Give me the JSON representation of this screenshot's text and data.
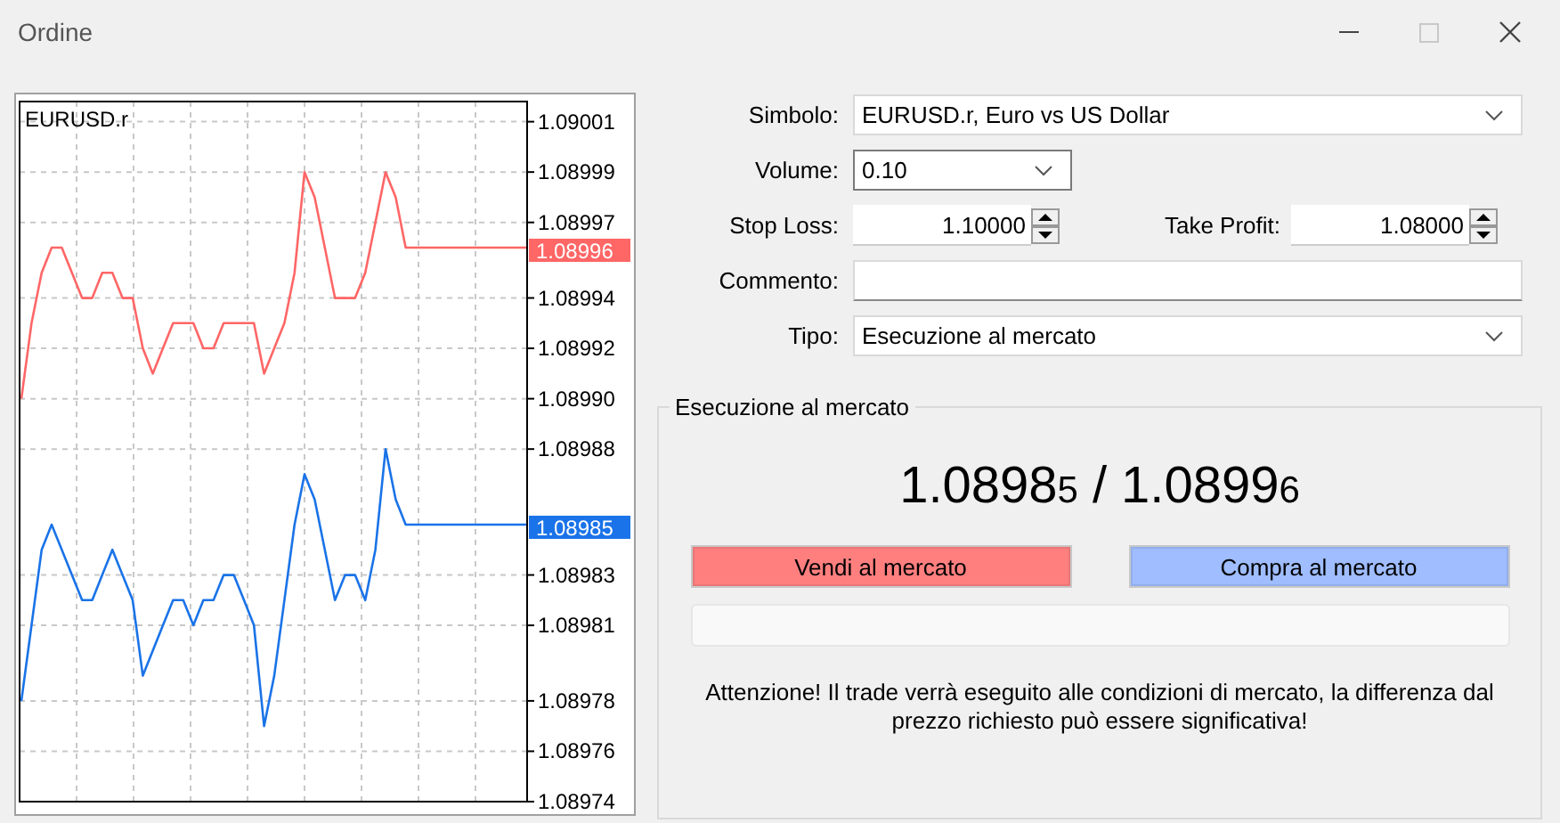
{
  "window": {
    "title": "Ordine",
    "maximize_disabled": true
  },
  "chart": {
    "price_tags": [
      {
        "label": "1.08996",
        "color": "#ff6666"
      },
      {
        "label": "1.08985",
        "color": "#1a73e8"
      }
    ],
    "chart_data": {
      "type": "line",
      "title": "EURUSD.r",
      "grid": true,
      "ylim": [
        1.08974,
        1.090018
      ],
      "yticks": [
        {
          "value": 1.09001,
          "label": "1.09001"
        },
        {
          "value": 1.08999,
          "label": "1.08999"
        },
        {
          "value": 1.08997,
          "label": "1.08997"
        },
        {
          "value": 1.08994,
          "label": "1.08994"
        },
        {
          "value": 1.08992,
          "label": "1.08992"
        },
        {
          "value": 1.0899,
          "label": "1.08990"
        },
        {
          "value": 1.08988,
          "label": "1.08988"
        },
        {
          "value": 1.08983,
          "label": "1.08983"
        },
        {
          "value": 1.08981,
          "label": "1.08981"
        },
        {
          "value": 1.08978,
          "label": "1.08978"
        },
        {
          "value": 1.08976,
          "label": "1.08976"
        },
        {
          "value": 1.08974,
          "label": "1.08974"
        }
      ],
      "series": [
        {
          "color": "#ff6666",
          "values": [
            1.0899,
            1.08993,
            1.08995,
            1.08996,
            1.08996,
            1.08995,
            1.08994,
            1.08994,
            1.08995,
            1.08995,
            1.08994,
            1.08994,
            1.08992,
            1.08991,
            1.08992,
            1.08993,
            1.08993,
            1.08993,
            1.08992,
            1.08992,
            1.08993,
            1.08993,
            1.08993,
            1.08993,
            1.08991,
            1.08992,
            1.08993,
            1.08995,
            1.08999,
            1.08998,
            1.08996,
            1.08994,
            1.08994,
            1.08994,
            1.08995,
            1.08997,
            1.08999,
            1.08998,
            1.08996,
            1.08996,
            1.08996,
            1.08996,
            1.08996,
            1.08996,
            1.08996,
            1.08996,
            1.08996,
            1.08996,
            1.08996,
            1.08996,
            1.08996
          ]
        },
        {
          "color": "#1a73e8",
          "values": [
            1.08978,
            1.08981,
            1.08984,
            1.08985,
            1.08984,
            1.08983,
            1.08982,
            1.08982,
            1.08983,
            1.08984,
            1.08983,
            1.08982,
            1.08979,
            1.0898,
            1.08981,
            1.08982,
            1.08982,
            1.08981,
            1.08982,
            1.08982,
            1.08983,
            1.08983,
            1.08982,
            1.08981,
            1.08977,
            1.08979,
            1.08982,
            1.08985,
            1.08987,
            1.08986,
            1.08984,
            1.08982,
            1.08983,
            1.08983,
            1.08982,
            1.08984,
            1.08988,
            1.08986,
            1.08985,
            1.08985,
            1.08985,
            1.08985,
            1.08985,
            1.08985,
            1.08985,
            1.08985,
            1.08985,
            1.08985,
            1.08985,
            1.08985,
            1.08985
          ]
        }
      ]
    }
  },
  "form": {
    "symbol": {
      "label": "Simbolo:",
      "value": "EURUSD.r, Euro vs US Dollar"
    },
    "volume": {
      "label": "Volume:",
      "value": "0.10"
    },
    "stop_loss": {
      "label": "Stop Loss:",
      "value": "1.10000"
    },
    "take_profit": {
      "label": "Take Profit:",
      "value": "1.08000"
    },
    "comment": {
      "label": "Commento:"
    },
    "type": {
      "label": "Tipo:",
      "value": "Esecuzione al mercato"
    }
  },
  "execution": {
    "title": "Esecuzione al mercato",
    "bid": {
      "main": "1.0898",
      "pip": "5"
    },
    "separator": "/",
    "ask": {
      "main": "1.0899",
      "pip": "6"
    },
    "sell_button": "Vendi al mercato",
    "buy_button": "Compra al mercato",
    "warning": "Attenzione! Il trade verrà eseguito alle condizioni di mercato, la differenza dal prezzo richiesto può essere significativa!"
  }
}
